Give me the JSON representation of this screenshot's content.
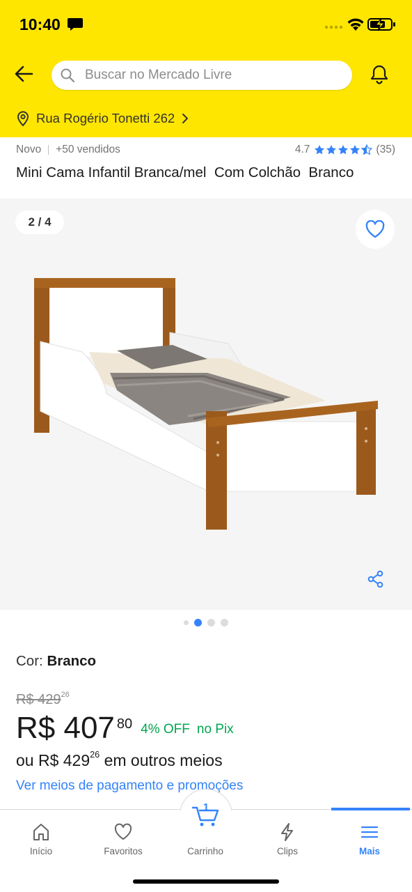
{
  "status_bar": {
    "time": "10:40"
  },
  "header": {
    "search_placeholder": "Buscar no Mercado Livre",
    "address": "Rua Rogério Tonetti 262"
  },
  "product": {
    "condition": "Novo",
    "sold": "+50 vendidos",
    "rating": "4.7",
    "rating_stars": 4.7,
    "reviews": "(35)",
    "title": "Mini Cama Infantil Branca/mel  Com Colchão  Branco",
    "gallery_counter": "2 / 4",
    "color_label": "Cor:",
    "color_value": "Branco",
    "old_price_int": "R$ 429",
    "old_price_cents": "26",
    "price_int": "R$ 407",
    "price_cents": "80",
    "discount": "4% OFF",
    "pix": "no Pix",
    "installments_prefix": "ou R$ 429",
    "installments_cents": "26",
    "installments_suffix": " em outros meios",
    "payment_link": "Ver meios de pagamento e promoções"
  },
  "gallery": {
    "current_image": 2,
    "total_images": 4
  },
  "bottom_nav": {
    "items": [
      {
        "label": "Início",
        "icon": "home-icon"
      },
      {
        "label": "Favoritos",
        "icon": "heart-icon"
      },
      {
        "label": "Carrinho",
        "icon": "cart-icon"
      },
      {
        "label": "Clips",
        "icon": "lightning-icon"
      },
      {
        "label": "Mais",
        "icon": "menu-icon"
      }
    ],
    "cart_count": "1",
    "active": "Mais"
  },
  "colors": {
    "brand_yellow": "#ffe600",
    "accent_blue": "#3483fa",
    "discount_green": "#00a650"
  }
}
